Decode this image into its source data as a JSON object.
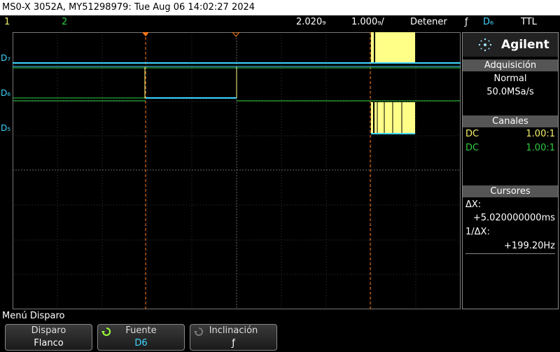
{
  "title": "MS0-X 3052A, MY51298979: Tue Aug 06 14:02:27 2024",
  "status": {
    "ch1": "1",
    "ch2": "2",
    "timebase": "2.020₉",
    "vert_scale": "1.000₉/",
    "run_mode": "Detener",
    "trigger_edge": "ƒ",
    "trigger_source": "D₆",
    "trigger_level": "TTL"
  },
  "channel_labels": {
    "d7": "D₇",
    "d6": "D₆",
    "d5": "D₅"
  },
  "side_panel": {
    "brand": "Agilent",
    "acq_header": "Adquisición",
    "acq_mode": "Normal",
    "acq_rate": "50.0MSa/s",
    "channels_header": "Canales",
    "ch1_coupling": "DC",
    "ch1_probe": "1.00:1",
    "ch2_coupling": "DC",
    "ch2_probe": "1.00:1",
    "cursors_header": "Cursores",
    "dx_label": "ΔX:",
    "dx_value": "+5.020000000ms",
    "inv_dx_label": "1/ΔX:",
    "inv_dx_value": "+199.20Hz"
  },
  "menu": {
    "title": "Menú Disparo",
    "buttons": [
      {
        "top": "Disparo",
        "bottom": "Flanco"
      },
      {
        "top": "Fuente",
        "bottom": "D6"
      },
      {
        "top": "Inclinación",
        "bottom": "ƒ"
      }
    ]
  },
  "colors": {
    "ch1": "#f5f26a",
    "ch2": "#2ecc40",
    "digital": "#3fd6ff",
    "cursor": "#ff7a1a"
  }
}
